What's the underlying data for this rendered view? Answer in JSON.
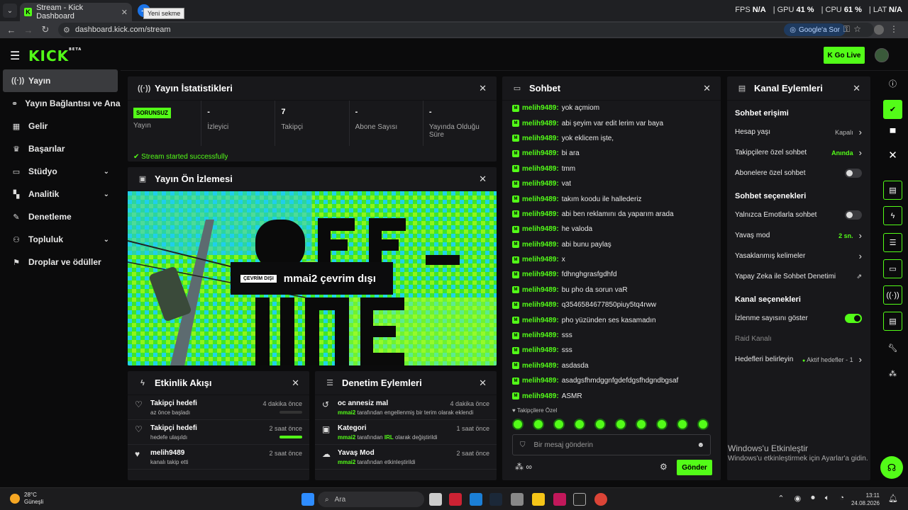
{
  "browser": {
    "tab_title": "Stream - Kick Dashboard",
    "tooltip": "Yeni sekme",
    "url": "dashboard.kick.com/stream",
    "google_btn": "Google'a Sor"
  },
  "hud": {
    "fps_label": "FPS",
    "fps": "N/A",
    "gpu_label": "GPU",
    "gpu": "41 %",
    "cpu_label": "CPU",
    "cpu": "61 %",
    "lat_label": "LAT",
    "lat": "N/A"
  },
  "header": {
    "logo": "KICK",
    "beta": "BETA",
    "go_live": "Go Live"
  },
  "sidebar": {
    "items": [
      {
        "label": "Yayın",
        "icon": "broadcast-icon",
        "chev": ""
      },
      {
        "label": "Yayın Bağlantısı ve Anahtarı",
        "icon": "link-icon",
        "chev": ""
      },
      {
        "label": "Gelir",
        "icon": "revenue-icon",
        "chev": ""
      },
      {
        "label": "Başarılar",
        "icon": "trophy-icon",
        "chev": ""
      },
      {
        "label": "Stüdyo",
        "icon": "studio-icon",
        "chev": "⌄"
      },
      {
        "label": "Analitik",
        "icon": "chart-icon",
        "chev": "⌄"
      },
      {
        "label": "Denetleme",
        "icon": "wrench-icon",
        "chev": ""
      },
      {
        "label": "Topluluk",
        "icon": "community-icon",
        "chev": "⌄"
      },
      {
        "label": "Droplar ve ödüller",
        "icon": "gift-icon",
        "chev": ""
      }
    ]
  },
  "stats_panel": {
    "title": "Yayın İstatistikleri",
    "status_badge": "SORUNSUZ",
    "stats": [
      {
        "value": "",
        "label": "Yayın"
      },
      {
        "value": "-",
        "label": "İzleyici"
      },
      {
        "value": "7",
        "label": "Takipçi"
      },
      {
        "value": "-",
        "label": "Abone Sayısı"
      },
      {
        "value": "-",
        "label": "Yayında Olduğu Süre"
      }
    ],
    "message": "Stream started successfully"
  },
  "preview_panel": {
    "title": "Yayın Ön İzlemesi",
    "offline_badge": "ÇEVRİM DIŞI",
    "offline_text": "mmai2 çevrim dışı"
  },
  "activity_panel": {
    "title": "Etkinlik Akışı",
    "items": [
      {
        "title": "Takipçi hedefi",
        "sub": "az önce başladı",
        "time": "4 dakika önce",
        "progress": 0
      },
      {
        "title": "Takipçi hedefi",
        "sub": "hedefe ulaşıldı",
        "time": "2 saat önce",
        "progress": 1
      },
      {
        "title": "melih9489",
        "sub": "kanalı takip etti",
        "time": "2 saat önce"
      }
    ]
  },
  "moderation_panel": {
    "title": "Denetim Eylemleri",
    "items": [
      {
        "title": "oc annesiz mal",
        "user": "mmai2",
        "sub": "tarafından engellenmiş bir terim olarak eklendi",
        "highlight": "",
        "sub2": "",
        "time": "4 dakika önce"
      },
      {
        "title": "Kategori",
        "user": "mmai2",
        "sub": "tarafından",
        "highlight": "IRL",
        "sub2": "olarak değiştirildi",
        "time": "1 saat önce"
      },
      {
        "title": "Yavaş Mod",
        "user": "mmai2",
        "sub": "tarafından etkinleştirildi",
        "highlight": "",
        "sub2": "",
        "time": "2 saat önce"
      }
    ]
  },
  "chat_panel": {
    "title": "Sohbet",
    "messages": [
      {
        "user": "melih9489:",
        "text": "yok açmiom"
      },
      {
        "user": "melih9489:",
        "text": "abi şeyim var edit lerim var baya"
      },
      {
        "user": "melih9489:",
        "text": "yok eklicem işte,"
      },
      {
        "user": "melih9489:",
        "text": "bi ara"
      },
      {
        "user": "melih9489:",
        "text": "tmm"
      },
      {
        "user": "melih9489:",
        "text": "vat"
      },
      {
        "user": "melih9489:",
        "text": "takım koodu ile hallederiz"
      },
      {
        "user": "melih9489:",
        "text": "abi ben reklamını da yaparım arada"
      },
      {
        "user": "melih9489:",
        "text": "he valoda"
      },
      {
        "user": "melih9489:",
        "text": "abi bunu paylaş"
      },
      {
        "user": "melih9489:",
        "text": "x"
      },
      {
        "user": "melih9489:",
        "text": "fdhnghgrasfgdhfd"
      },
      {
        "user": "melih9489:",
        "text": "bu pho da sorun vaR"
      },
      {
        "user": "melih9489:",
        "text": "q3546584677850piuy5tq4rww"
      },
      {
        "user": "melih9489:",
        "text": "pho yüzünden ses kasamadın"
      },
      {
        "user": "melih9489:",
        "text": "sss"
      },
      {
        "user": "melih9489:",
        "text": "sss"
      },
      {
        "user": "melih9489:",
        "text": "asdasda"
      },
      {
        "user": "melih9489:",
        "text": "asadgsfhmdggnfgdefdgsfhdgndbgsaf"
      },
      {
        "user": "melih9489:",
        "text": "ASMR"
      }
    ],
    "followers_only": "Takipçilere Özel",
    "input_placeholder": "Bir mesaj gönderin",
    "send": "Gönder"
  },
  "channel_panel": {
    "title": "Kanal Eylemleri",
    "sections": [
      {
        "title": "Sohbet erişimi",
        "rows": [
          {
            "label": "Hesap yaşı",
            "value": "Kapalı",
            "kind": "chevron",
            "green": false
          },
          {
            "label": "Takipçilere özel sohbet",
            "value": "Anında",
            "kind": "chevron",
            "green": true
          },
          {
            "label": "Abonelere özel sohbet",
            "value": "",
            "kind": "toggle",
            "on": false
          }
        ]
      },
      {
        "title": "Sohbet seçenekleri",
        "rows": [
          {
            "label": "Yalnızca Emotlarla sohbet",
            "value": "",
            "kind": "toggle",
            "on": false
          },
          {
            "label": "Yavaş mod",
            "value": "2 sn.",
            "kind": "chevron",
            "green": true
          },
          {
            "label": "Yasaklanmış kelimeler",
            "value": "",
            "kind": "chevron",
            "green": false
          },
          {
            "label": "Yapay Zeka ile Sohbet Denetimi",
            "value": "",
            "kind": "external",
            "green": false
          }
        ]
      },
      {
        "title": "Kanal seçenekleri",
        "rows": [
          {
            "label": "İzlenme sayısını göster",
            "value": "",
            "kind": "toggle",
            "on": true
          },
          {
            "label": "Raid Kanalı",
            "value": "",
            "kind": "none",
            "dim": true
          },
          {
            "label": "Hedefleri belirleyin",
            "value": "Aktif hedefler - 1",
            "kind": "chevron",
            "green": false,
            "dot": true
          }
        ]
      }
    ]
  },
  "windows": {
    "activate_title": "Windows'u Etkinleştir",
    "activate_sub": "Windows'u etkinleştirmek için Ayarlar'a gidin."
  },
  "taskbar": {
    "temp": "28°C",
    "weather": "Güneşli",
    "search": "Ara",
    "time": "13:11",
    "date": "24.08.2026"
  }
}
